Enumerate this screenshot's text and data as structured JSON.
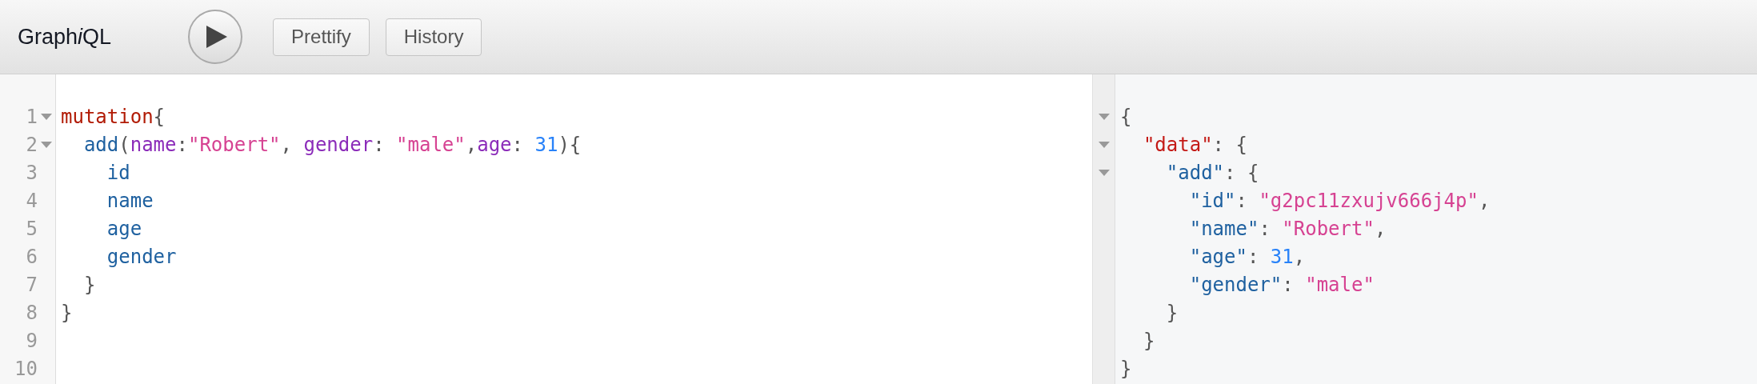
{
  "toolbar": {
    "title_parts": [
      {
        "text": "Graph",
        "italic": false
      },
      {
        "text": "i",
        "italic": true
      },
      {
        "text": "QL",
        "italic": false
      }
    ],
    "buttons": [
      {
        "label": "Prettify"
      },
      {
        "label": "History"
      }
    ]
  },
  "query_editor": {
    "lines": [
      {
        "number": "1",
        "foldable": true,
        "tokens": [
          {
            "kind": "keyword",
            "text": "mutation"
          },
          {
            "kind": "punct",
            "text": "{"
          }
        ]
      },
      {
        "number": "2",
        "foldable": true,
        "tokens": [
          {
            "kind": "def",
            "text": "  add"
          },
          {
            "kind": "punct",
            "text": "("
          },
          {
            "kind": "attribute",
            "text": "name"
          },
          {
            "kind": "punct",
            "text": ":"
          },
          {
            "kind": "string",
            "text": "\"Robert\""
          },
          {
            "kind": "punct",
            "text": ", "
          },
          {
            "kind": "attribute",
            "text": "gender"
          },
          {
            "kind": "punct",
            "text": ": "
          },
          {
            "kind": "string",
            "text": "\"male\""
          },
          {
            "kind": "punct",
            "text": ","
          },
          {
            "kind": "attribute",
            "text": "age"
          },
          {
            "kind": "punct",
            "text": ": "
          },
          {
            "kind": "number",
            "text": "31"
          },
          {
            "kind": "punct",
            "text": "){"
          }
        ]
      },
      {
        "number": "3",
        "foldable": false,
        "tokens": [
          {
            "kind": "def",
            "text": "    id"
          }
        ]
      },
      {
        "number": "4",
        "foldable": false,
        "tokens": [
          {
            "kind": "def",
            "text": "    name"
          }
        ]
      },
      {
        "number": "5",
        "foldable": false,
        "tokens": [
          {
            "kind": "def",
            "text": "    age"
          }
        ]
      },
      {
        "number": "6",
        "foldable": false,
        "tokens": [
          {
            "kind": "def",
            "text": "    gender"
          }
        ]
      },
      {
        "number": "7",
        "foldable": false,
        "tokens": [
          {
            "kind": "punct",
            "text": "  }"
          }
        ]
      },
      {
        "number": "8",
        "foldable": false,
        "tokens": [
          {
            "kind": "punct",
            "text": "}"
          }
        ]
      },
      {
        "number": "9",
        "foldable": false
      },
      {
        "number": "10",
        "foldable": false
      }
    ]
  },
  "result_viewer": {
    "lines": [
      {
        "foldable": true,
        "tokens": [
          {
            "kind": "punct",
            "text": "{"
          }
        ]
      },
      {
        "foldable": true,
        "tokens": [
          {
            "kind": "top-key",
            "text": "  \"data\""
          },
          {
            "kind": "punct",
            "text": ": {"
          }
        ]
      },
      {
        "foldable": true,
        "tokens": [
          {
            "kind": "def",
            "text": "    \"add\""
          },
          {
            "kind": "punct",
            "text": ": {"
          }
        ]
      },
      {
        "foldable": false,
        "tokens": [
          {
            "kind": "def",
            "text": "      \"id\""
          },
          {
            "kind": "punct",
            "text": ": "
          },
          {
            "kind": "string",
            "text": "\"g2pc11zxujv666j4p\""
          },
          {
            "kind": "punct",
            "text": ","
          }
        ]
      },
      {
        "foldable": false,
        "tokens": [
          {
            "kind": "def",
            "text": "      \"name\""
          },
          {
            "kind": "punct",
            "text": ": "
          },
          {
            "kind": "string",
            "text": "\"Robert\""
          },
          {
            "kind": "punct",
            "text": ","
          }
        ]
      },
      {
        "foldable": false,
        "tokens": [
          {
            "kind": "def",
            "text": "      \"age\""
          },
          {
            "kind": "punct",
            "text": ": "
          },
          {
            "kind": "number",
            "text": "31"
          },
          {
            "kind": "punct",
            "text": ","
          }
        ]
      },
      {
        "foldable": false,
        "tokens": [
          {
            "kind": "def",
            "text": "      \"gender\""
          },
          {
            "kind": "punct",
            "text": ": "
          },
          {
            "kind": "string",
            "text": "\"male\""
          }
        ]
      },
      {
        "foldable": false,
        "tokens": [
          {
            "kind": "punct",
            "text": "    }"
          }
        ]
      },
      {
        "foldable": false,
        "tokens": [
          {
            "kind": "punct",
            "text": "  }"
          }
        ]
      },
      {
        "foldable": false,
        "tokens": [
          {
            "kind": "punct",
            "text": "}"
          }
        ]
      }
    ]
  }
}
